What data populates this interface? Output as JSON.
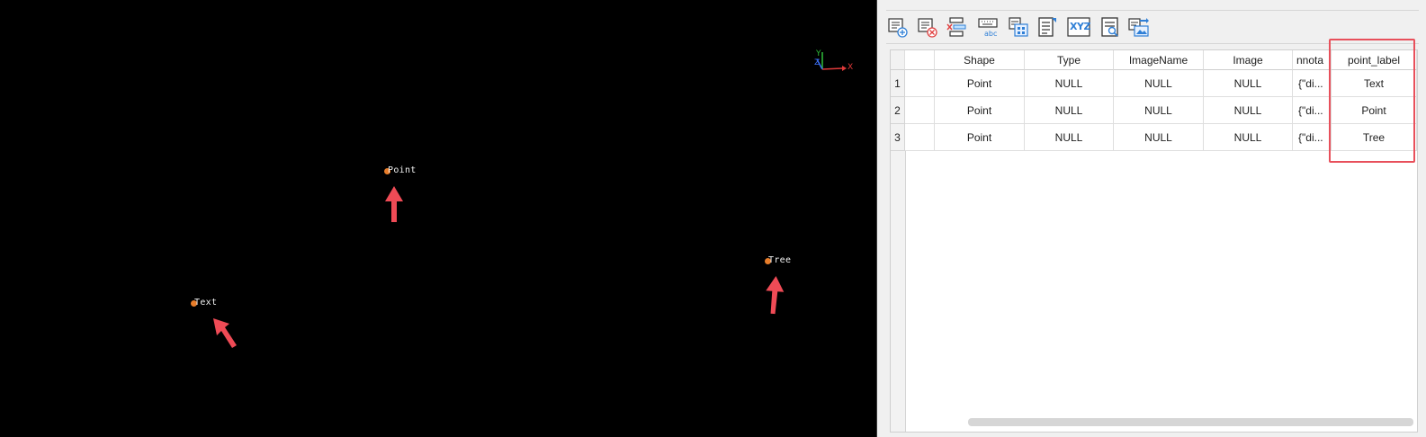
{
  "viewport": {
    "points": [
      {
        "label": "Point",
        "color": "#e87d2a"
      },
      {
        "label": "Tree",
        "color": "#e87d2a"
      },
      {
        "label": "Text",
        "color": "#e87d2a"
      }
    ],
    "annotation_color": "#ef4b56",
    "axis": {
      "x_label": "X",
      "y_label": "Y",
      "z_label": "Z"
    }
  },
  "toolbar": {
    "buttons": [
      {
        "name": "add-row-icon"
      },
      {
        "name": "delete-row-icon"
      },
      {
        "name": "delete-column-icon"
      },
      {
        "name": "text-field-icon"
      },
      {
        "name": "field-calculator-icon"
      },
      {
        "name": "edit-properties-icon"
      },
      {
        "name": "xyz-icon",
        "text": "XYZ"
      },
      {
        "name": "find-replace-icon"
      },
      {
        "name": "export-image-icon"
      }
    ]
  },
  "table": {
    "columns": [
      "",
      "Shape",
      "Type",
      "ImageName",
      "Image",
      "nnota",
      "point_label"
    ],
    "rows": [
      {
        "num": "1",
        "cells": [
          "",
          "Point",
          "NULL",
          "NULL",
          "NULL",
          "{\"di...",
          "Text"
        ]
      },
      {
        "num": "2",
        "cells": [
          "",
          "Point",
          "NULL",
          "NULL",
          "NULL",
          "{\"di...",
          "Point"
        ]
      },
      {
        "num": "3",
        "cells": [
          "",
          "Point",
          "NULL",
          "NULL",
          "NULL",
          "{\"di...",
          "Tree"
        ]
      }
    ],
    "highlight_color": "#e8505b"
  }
}
